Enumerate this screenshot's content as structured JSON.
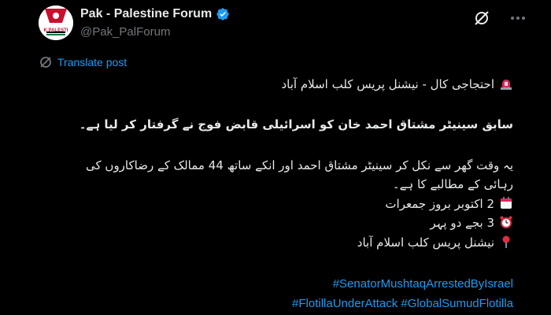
{
  "author": {
    "display_name": "Pak - Palestine Forum",
    "handle": "@Pak_PalForum",
    "avatar_text": "K PALESTI"
  },
  "actions": {
    "translate_label": "Translate post"
  },
  "post": {
    "line1": "احتجاجی کال - نیشنل پریس کلب اسلام آباد",
    "line2": "سابق سینیٹر مشتاق احمد خان کو اسرائیلی قابض فوج نے گرفتار کر لیا ہے۔",
    "line3a": "یہ وقت گھر سے نکل کر سینیٹر مشتاق احمد اور انکے ساتھ 44 ممالک کے رضاکاروں کی",
    "line3b": "رہائی کے مطالبے کا ہے۔",
    "date_line": "2 اکتوبر بروز جمعرات",
    "time_line": "3 بجے دو پہر",
    "venue_line": "نیشنل پریس کلب اسلام آباد"
  },
  "hashtags": {
    "tag1": "#SenatorMushtaqArrestedByIsrael",
    "tag2": "#FlotillaUnderAttack",
    "tag3": "#GlobalSumudFlotilla"
  },
  "icons": {
    "verified": "verified-badge-icon",
    "grok": "grok-icon",
    "more": "more-options-icon",
    "translate": "translate-icon",
    "siren": "siren-emoji-icon",
    "calendar": "calendar-emoji-icon",
    "clock": "alarm-clock-emoji-icon",
    "pin": "round-pushpin-emoji-icon"
  },
  "colors": {
    "background": "#000000",
    "text": "#e7e9ea",
    "secondary_text": "#71767b",
    "link": "#1d9bf0",
    "verified": "#1d9bf0"
  }
}
